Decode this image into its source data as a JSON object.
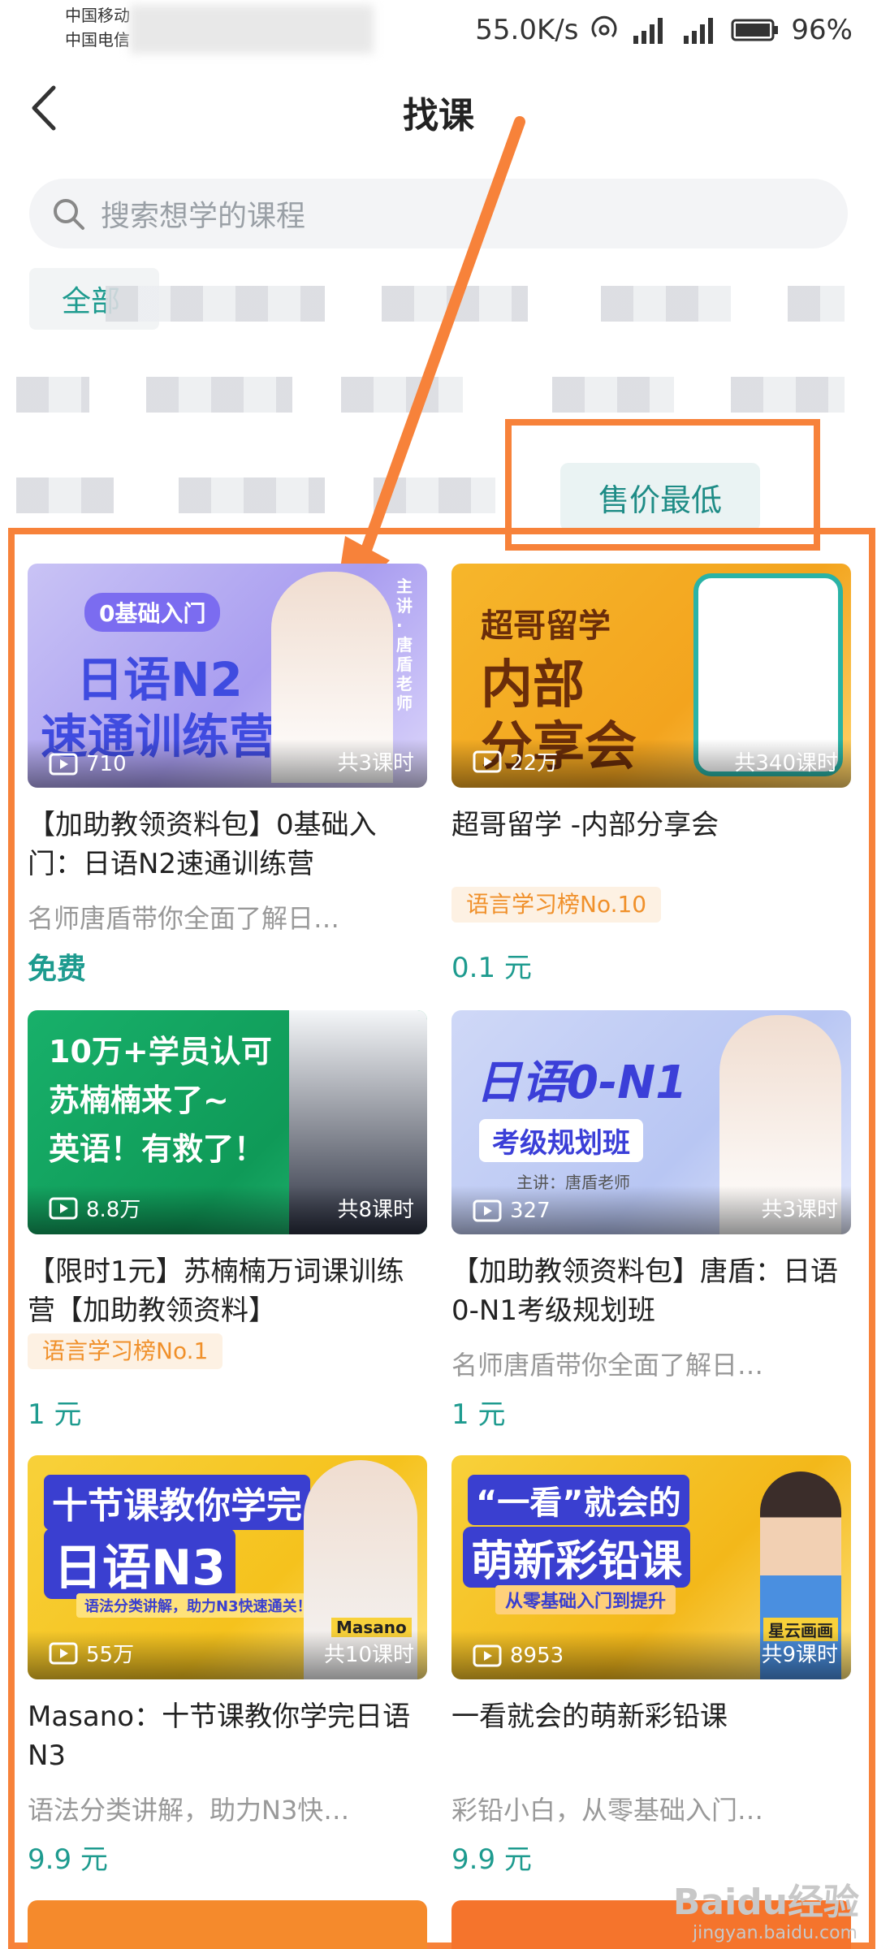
{
  "status_bar": {
    "carrier_1": "中国移动",
    "carrier_2": "中国电信",
    "speed": "55.0K/s",
    "battery": "96%"
  },
  "header": {
    "back_icon": "chevron-left-icon",
    "title": "找课"
  },
  "search": {
    "placeholder": "搜索想学的课程",
    "icon": "search-icon"
  },
  "filters": {
    "category_all": "全部",
    "sort_selected": "售价最低"
  },
  "accent_colors": {
    "teal": "#1e9b8f",
    "orange_annotation": "#f7823a",
    "badge_orange": "#f0902a"
  },
  "courses": [
    {
      "thumb_lines": [
        "0基础入门",
        "日语N2",
        "速通训练营"
      ],
      "thumb_side": "主讲·唐盾老师",
      "views": "710",
      "lessons": "共3课时",
      "title": "【加助教领资料包】0基础入门：日语N2速通训练营",
      "desc": "名师唐盾带你全面了解日…",
      "price": "免费"
    },
    {
      "thumb_lines": [
        "超哥留学",
        "内部",
        "分享会"
      ],
      "views": "22万",
      "lessons": "共340课时",
      "title": "超哥留学 -内部分享会",
      "badge": "语言学习榜No.10",
      "price": "0.1 元"
    },
    {
      "thumb_lines": [
        "10万+学员认可",
        "苏楠楠来了~",
        "英语！有救了！"
      ],
      "views": "8.8万",
      "lessons": "共8课时",
      "title": "【限时1元】苏楠楠万词课训练营【加助教领资料】",
      "badge": "语言学习榜No.1",
      "price": "1 元"
    },
    {
      "thumb_lines": [
        "日语0-N1",
        "考级规划班",
        "主讲：唐盾老师"
      ],
      "views": "327",
      "lessons": "共3课时",
      "title": "【加助教领资料包】唐盾：日语0-N1考级规划班",
      "desc": "名师唐盾带你全面了解日…",
      "price": "1 元"
    },
    {
      "thumb_lines": [
        "十节课教你学完",
        "日语N3",
        "语法分类讲解，助力N3快速通关！",
        "Masano"
      ],
      "views": "55万",
      "lessons": "共10课时",
      "title": "Masano：十节课教你学完日语N3",
      "desc": "语法分类讲解，助力N3快…",
      "price": "9.9 元"
    },
    {
      "thumb_lines": [
        "“一看”就会的",
        "萌新彩铅课",
        "从零基础入门到提升",
        "星云画画"
      ],
      "views": "8953",
      "lessons": "共9课时",
      "title": "一看就会的萌新彩铅课",
      "desc": "彩铅小白，从零基础入门…",
      "price": "9.9 元"
    }
  ],
  "watermark": {
    "brand": "Baidu经验",
    "url": "jingyan.baidu.com"
  }
}
